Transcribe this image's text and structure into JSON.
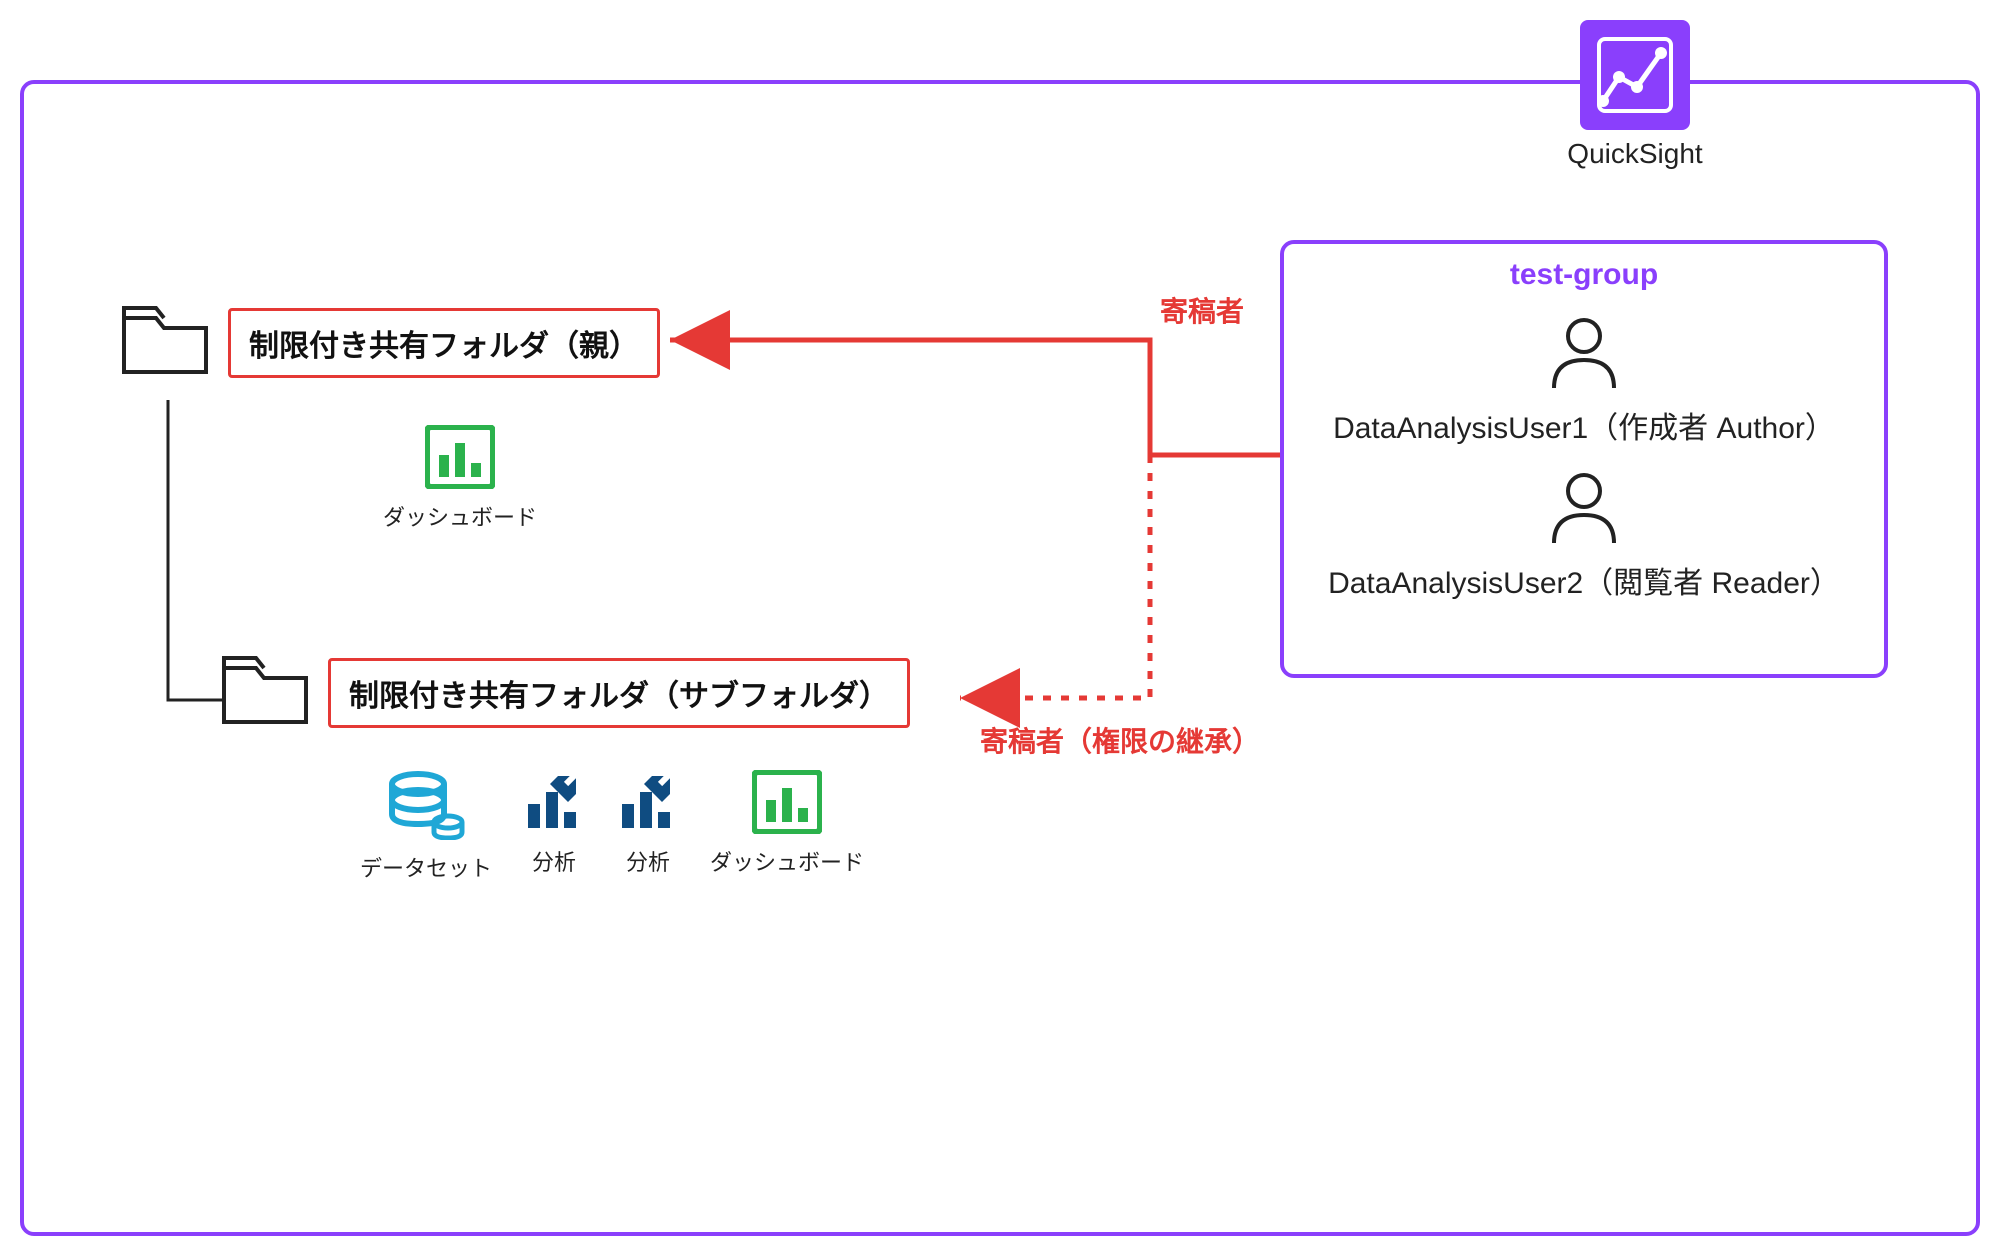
{
  "service": {
    "name": "QuickSight"
  },
  "group": {
    "title": "test-group",
    "users": [
      {
        "label": "DataAnalysisUser1（作成者 Author）"
      },
      {
        "label": "DataAnalysisUser2（閲覧者 Reader）"
      }
    ]
  },
  "folders": {
    "parent": {
      "title": "制限付き共有フォルダ（親）",
      "children": [
        {
          "type": "dashboard",
          "label": "ダッシュボード"
        }
      ]
    },
    "sub": {
      "title": "制限付き共有フォルダ（サブフォルダ）",
      "children": [
        {
          "type": "dataset",
          "label": "データセット"
        },
        {
          "type": "analysis",
          "label": "分析"
        },
        {
          "type": "analysis",
          "label": "分析"
        },
        {
          "type": "dashboard",
          "label": "ダッシュボード"
        }
      ]
    }
  },
  "arrows": {
    "contributor": "寄稿者",
    "contributor_inherited": "寄稿者（権限の継承）"
  },
  "colors": {
    "accent": "#8A3FFC",
    "warn": "#E53935",
    "green": "#2BB24C",
    "blue": "#0F4C81",
    "cyan": "#1FA7D6"
  }
}
